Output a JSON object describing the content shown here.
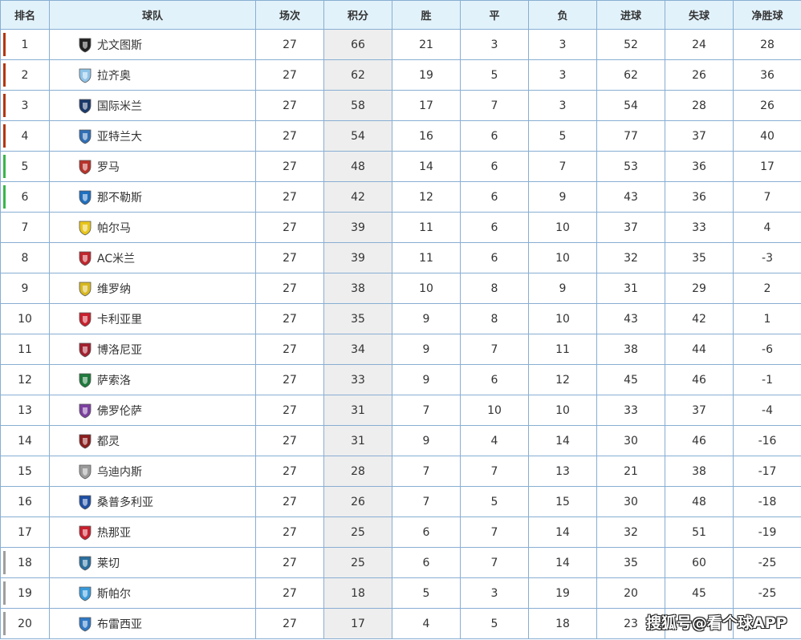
{
  "table": {
    "headers": {
      "rank": "排名",
      "team": "球队",
      "played": "场次",
      "points": "积分",
      "won": "胜",
      "drawn": "平",
      "lost": "负",
      "goals_for": "进球",
      "goals_against": "失球",
      "goal_diff": "净胜球"
    },
    "zone_colors": {
      "champions": "#b5360b",
      "europa": "#3bb54a",
      "relegation": "#9e9e9e"
    },
    "rows": [
      {
        "rank": "1",
        "team": "尤文图斯",
        "crest": "juventus-crest-icon",
        "crest_color": "#222222",
        "zone": "champions",
        "played": "27",
        "points": "66",
        "won": "21",
        "drawn": "3",
        "lost": "3",
        "gf": "52",
        "ga": "24",
        "gd": "28"
      },
      {
        "rank": "2",
        "team": "拉齐奥",
        "crest": "lazio-crest-icon",
        "crest_color": "#8fc3e8",
        "zone": "champions",
        "played": "27",
        "points": "62",
        "won": "19",
        "drawn": "5",
        "lost": "3",
        "gf": "62",
        "ga": "26",
        "gd": "36"
      },
      {
        "rank": "3",
        "team": "国际米兰",
        "crest": "inter-crest-icon",
        "crest_color": "#1b3a6b",
        "zone": "champions",
        "played": "27",
        "points": "58",
        "won": "17",
        "drawn": "7",
        "lost": "3",
        "gf": "54",
        "ga": "28",
        "gd": "26"
      },
      {
        "rank": "4",
        "team": "亚特兰大",
        "crest": "atalanta-crest-icon",
        "crest_color": "#2f6fb5",
        "zone": "champions",
        "played": "27",
        "points": "54",
        "won": "16",
        "drawn": "6",
        "lost": "5",
        "gf": "77",
        "ga": "37",
        "gd": "40"
      },
      {
        "rank": "5",
        "team": "罗马",
        "crest": "roma-crest-icon",
        "crest_color": "#b8322a",
        "zone": "europa",
        "played": "27",
        "points": "48",
        "won": "14",
        "drawn": "6",
        "lost": "7",
        "gf": "53",
        "ga": "36",
        "gd": "17"
      },
      {
        "rank": "6",
        "team": "那不勒斯",
        "crest": "napoli-crest-icon",
        "crest_color": "#1f6fbf",
        "zone": "europa",
        "played": "27",
        "points": "42",
        "won": "12",
        "drawn": "6",
        "lost": "9",
        "gf": "43",
        "ga": "36",
        "gd": "7"
      },
      {
        "rank": "7",
        "team": "帕尔马",
        "crest": "parma-crest-icon",
        "crest_color": "#e8c51a",
        "zone": "",
        "played": "27",
        "points": "39",
        "won": "11",
        "drawn": "6",
        "lost": "10",
        "gf": "37",
        "ga": "33",
        "gd": "4"
      },
      {
        "rank": "8",
        "team": "AC米兰",
        "crest": "ac-milan-crest-icon",
        "crest_color": "#c0262d",
        "zone": "",
        "played": "27",
        "points": "39",
        "won": "11",
        "drawn": "6",
        "lost": "10",
        "gf": "32",
        "ga": "35",
        "gd": "-3"
      },
      {
        "rank": "9",
        "team": "维罗纳",
        "crest": "verona-crest-icon",
        "crest_color": "#d8b820",
        "zone": "",
        "played": "27",
        "points": "38",
        "won": "10",
        "drawn": "8",
        "lost": "9",
        "gf": "31",
        "ga": "29",
        "gd": "2"
      },
      {
        "rank": "10",
        "team": "卡利亚里",
        "crest": "cagliari-crest-icon",
        "crest_color": "#c8202e",
        "zone": "",
        "played": "27",
        "points": "35",
        "won": "9",
        "drawn": "8",
        "lost": "10",
        "gf": "43",
        "ga": "42",
        "gd": "1"
      },
      {
        "rank": "11",
        "team": "博洛尼亚",
        "crest": "bologna-crest-icon",
        "crest_color": "#a3202e",
        "zone": "",
        "played": "27",
        "points": "34",
        "won": "9",
        "drawn": "7",
        "lost": "11",
        "gf": "38",
        "ga": "44",
        "gd": "-6"
      },
      {
        "rank": "12",
        "team": "萨索洛",
        "crest": "sassuolo-crest-icon",
        "crest_color": "#1e7a3c",
        "zone": "",
        "played": "27",
        "points": "33",
        "won": "9",
        "drawn": "6",
        "lost": "12",
        "gf": "45",
        "ga": "46",
        "gd": "-1"
      },
      {
        "rank": "13",
        "team": "佛罗伦萨",
        "crest": "fiorentina-crest-icon",
        "crest_color": "#7b3fa0",
        "zone": "",
        "played": "27",
        "points": "31",
        "won": "7",
        "drawn": "10",
        "lost": "10",
        "gf": "33",
        "ga": "37",
        "gd": "-4"
      },
      {
        "rank": "14",
        "team": "都灵",
        "crest": "torino-crest-icon",
        "crest_color": "#8b1e1e",
        "zone": "",
        "played": "27",
        "points": "31",
        "won": "9",
        "drawn": "4",
        "lost": "14",
        "gf": "30",
        "ga": "46",
        "gd": "-16"
      },
      {
        "rank": "15",
        "team": "乌迪内斯",
        "crest": "udinese-crest-icon",
        "crest_color": "#9a9a9a",
        "zone": "",
        "played": "27",
        "points": "28",
        "won": "7",
        "drawn": "7",
        "lost": "13",
        "gf": "21",
        "ga": "38",
        "gd": "-17"
      },
      {
        "rank": "16",
        "team": "桑普多利亚",
        "crest": "sampdoria-crest-icon",
        "crest_color": "#1e4fa3",
        "zone": "",
        "played": "27",
        "points": "26",
        "won": "7",
        "drawn": "5",
        "lost": "15",
        "gf": "30",
        "ga": "48",
        "gd": "-18"
      },
      {
        "rank": "17",
        "team": "热那亚",
        "crest": "genoa-crest-icon",
        "crest_color": "#c8202e",
        "zone": "",
        "played": "27",
        "points": "25",
        "won": "6",
        "drawn": "7",
        "lost": "14",
        "gf": "32",
        "ga": "51",
        "gd": "-19"
      },
      {
        "rank": "18",
        "team": "莱切",
        "crest": "lecce-crest-icon",
        "crest_color": "#2a6f9e",
        "zone": "relegation",
        "played": "27",
        "points": "25",
        "won": "6",
        "drawn": "7",
        "lost": "14",
        "gf": "35",
        "ga": "60",
        "gd": "-25"
      },
      {
        "rank": "19",
        "team": "斯帕尔",
        "crest": "spal-crest-icon",
        "crest_color": "#3a9ad9",
        "zone": "relegation",
        "played": "27",
        "points": "18",
        "won": "5",
        "drawn": "3",
        "lost": "19",
        "gf": "20",
        "ga": "45",
        "gd": "-25"
      },
      {
        "rank": "20",
        "team": "布雷西亚",
        "crest": "brescia-crest-icon",
        "crest_color": "#2f78c4",
        "zone": "relegation",
        "played": "27",
        "points": "17",
        "won": "4",
        "drawn": "5",
        "lost": "18",
        "gf": "23",
        "ga": "",
        "gd": ""
      }
    ]
  },
  "watermark": "搜狐号@看个球APP"
}
